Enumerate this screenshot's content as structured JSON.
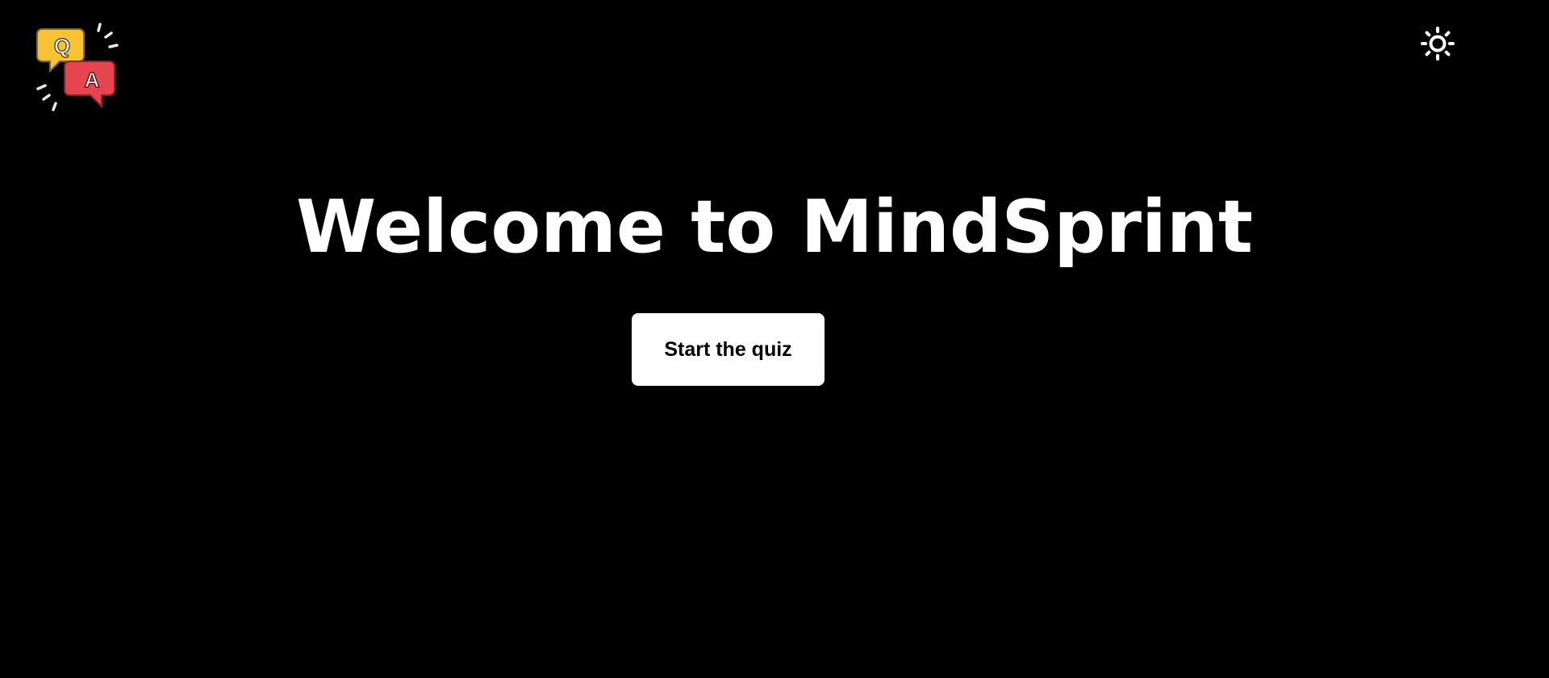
{
  "header": {
    "logo_icon": "qa-speech-bubbles-icon",
    "logo_letters": [
      "Q",
      "A"
    ],
    "theme_toggle_icon": "sun-icon"
  },
  "hero": {
    "title": "Welcome to MindSprint",
    "start_button_label": "Start the quiz"
  },
  "colors": {
    "background": "#000000",
    "text": "#ffffff",
    "button_bg": "#ffffff",
    "button_text": "#000000",
    "logo_q_bubble": "#f7c233",
    "logo_a_bubble": "#e64550"
  }
}
